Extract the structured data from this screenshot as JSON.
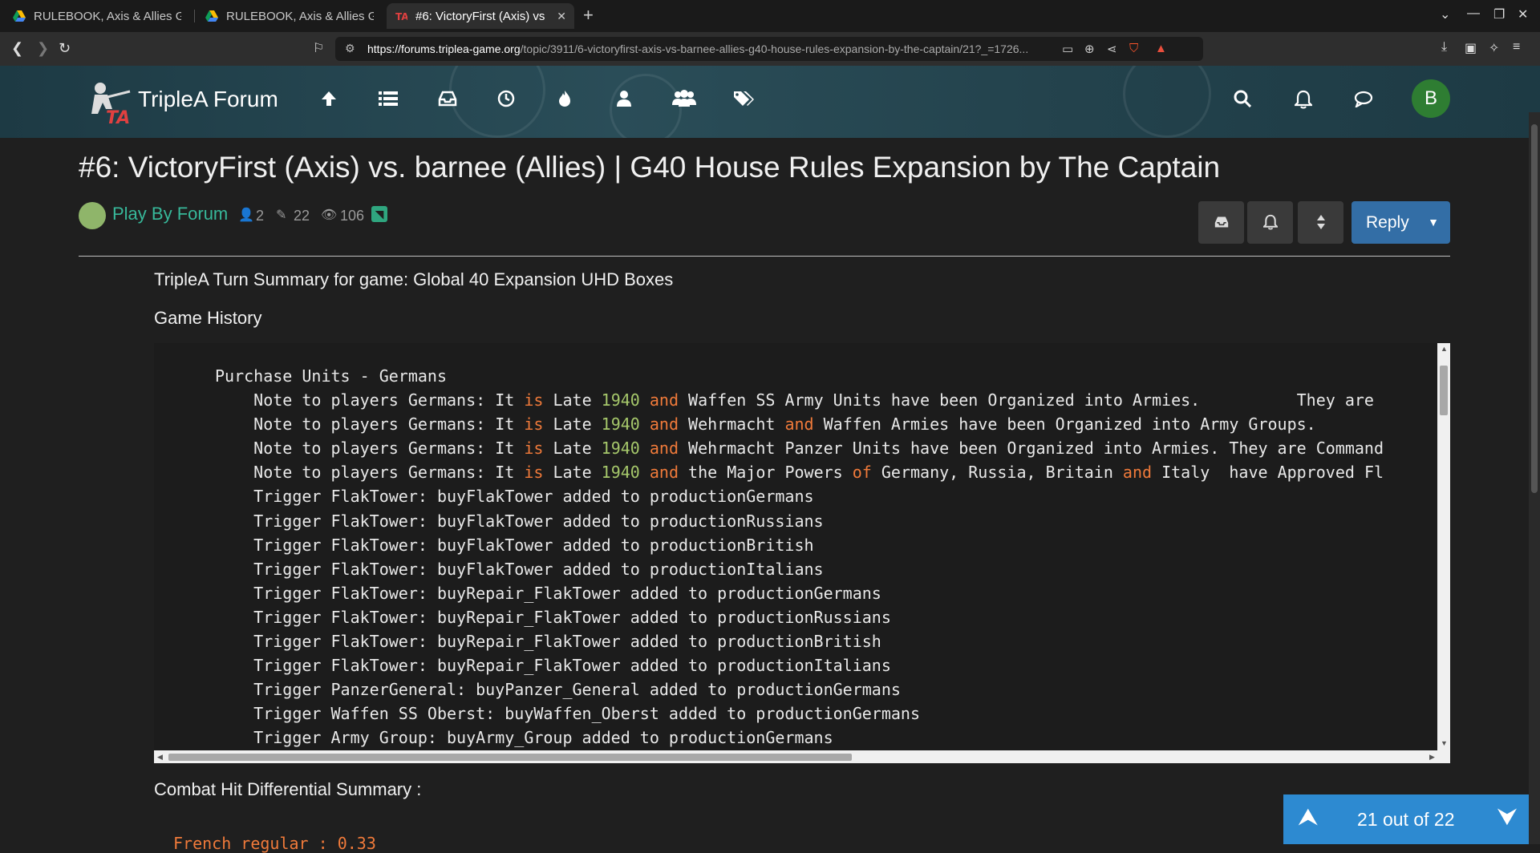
{
  "browser": {
    "tabs": [
      {
        "title": "RULEBOOK, Axis & Allies Gl",
        "icon": "google-drive-icon",
        "active": false
      },
      {
        "title": "RULEBOOK, Axis & Allies Gl",
        "icon": "google-drive-icon",
        "active": false
      },
      {
        "title": "#6: VictoryFirst (Axis) vs",
        "icon": "triplea-icon",
        "active": true
      }
    ],
    "url_host": "https://forums.triplea-game.org",
    "url_path": "/topic/3911/6-victoryfirst-axis-vs-barnee-allies-g40-house-rules-expansion-by-the-captain/21?_=1726...",
    "brave_badge": "1"
  },
  "forum": {
    "name": "TripleA Forum",
    "user_initial": "B",
    "nav_icons": [
      "arrow-up-icon",
      "list-icon",
      "inbox-icon",
      "clock-icon",
      "fire-icon",
      "user-icon",
      "users-icon",
      "tags-icon"
    ],
    "right_icons": [
      "search-icon",
      "bell-icon",
      "chat-icon"
    ]
  },
  "topic": {
    "title": "#6: VictoryFirst (Axis) vs. barnee (Allies) | G40 House Rules Expansion by The Captain",
    "category": "Play By Forum",
    "posters": "2",
    "posts": "22",
    "views": "106",
    "reply_label": "Reply"
  },
  "post": {
    "summary_title": "TripleA Turn Summary for game: Global 40 Expansion UHD Boxes",
    "history_heading": "Game History",
    "code_lines": [
      [
        {
          "t": "Purchase Units - Germans"
        }
      ],
      [
        {
          "t": "    Note to players Germans: It "
        },
        {
          "t": "is",
          "c": "kw"
        },
        {
          "t": " Late "
        },
        {
          "t": "1940",
          "c": "num"
        },
        {
          "t": " "
        },
        {
          "t": "and",
          "c": "kw"
        },
        {
          "t": " Waffen SS Army Units have been Organized into Armies.          They are"
        }
      ],
      [
        {
          "t": "    Note to players Germans: It "
        },
        {
          "t": "is",
          "c": "kw"
        },
        {
          "t": " Late "
        },
        {
          "t": "1940",
          "c": "num"
        },
        {
          "t": " "
        },
        {
          "t": "and",
          "c": "kw"
        },
        {
          "t": " Wehrmacht "
        },
        {
          "t": "and",
          "c": "kw"
        },
        {
          "t": " Waffen Armies have been Organized into Army Groups."
        }
      ],
      [
        {
          "t": "    Note to players Germans: It "
        },
        {
          "t": "is",
          "c": "kw"
        },
        {
          "t": " Late "
        },
        {
          "t": "1940",
          "c": "num"
        },
        {
          "t": " "
        },
        {
          "t": "and",
          "c": "kw"
        },
        {
          "t": " Wehrmacht Panzer Units have been Organized into Armies. They are Command"
        }
      ],
      [
        {
          "t": "    Note to players Germans: It "
        },
        {
          "t": "is",
          "c": "kw"
        },
        {
          "t": " Late "
        },
        {
          "t": "1940",
          "c": "num"
        },
        {
          "t": " "
        },
        {
          "t": "and",
          "c": "kw"
        },
        {
          "t": " the Major Powers "
        },
        {
          "t": "of",
          "c": "kw"
        },
        {
          "t": " Germany, Russia, Britain "
        },
        {
          "t": "and",
          "c": "kw"
        },
        {
          "t": " Italy  have Approved Fl"
        }
      ],
      [
        {
          "t": "    Trigger FlakTower: buyFlakTower added to productionGermans"
        }
      ],
      [
        {
          "t": "    Trigger FlakTower: buyFlakTower added to productionRussians"
        }
      ],
      [
        {
          "t": "    Trigger FlakTower: buyFlakTower added to productionBritish"
        }
      ],
      [
        {
          "t": "    Trigger FlakTower: buyFlakTower added to productionItalians"
        }
      ],
      [
        {
          "t": "    Trigger FlakTower: buyRepair_FlakTower added to productionGermans"
        }
      ],
      [
        {
          "t": "    Trigger FlakTower: buyRepair_FlakTower added to productionRussians"
        }
      ],
      [
        {
          "t": "    Trigger FlakTower: buyRepair_FlakTower added to productionBritish"
        }
      ],
      [
        {
          "t": "    Trigger FlakTower: buyRepair_FlakTower added to productionItalians"
        }
      ],
      [
        {
          "t": "    Trigger PanzerGeneral: buyPanzer_General added to productionGermans"
        }
      ],
      [
        {
          "t": "    Trigger Waffen SS Oberst: buyWaffen_Oberst added to productionGermans"
        }
      ],
      [
        {
          "t": "    Trigger Army Group: buyArmy_Group added to productionGermans"
        }
      ]
    ],
    "combat_heading": "Combat Hit Differential Summary :",
    "next_peek": "French regular : 0.33"
  },
  "pager": {
    "label": "21 out of 22"
  },
  "colors": {
    "keyword": "#f07a3a",
    "number": "#a6c86b",
    "accent": "#336ea6",
    "category": "#37b89a",
    "pager": "#2d8ad1"
  }
}
